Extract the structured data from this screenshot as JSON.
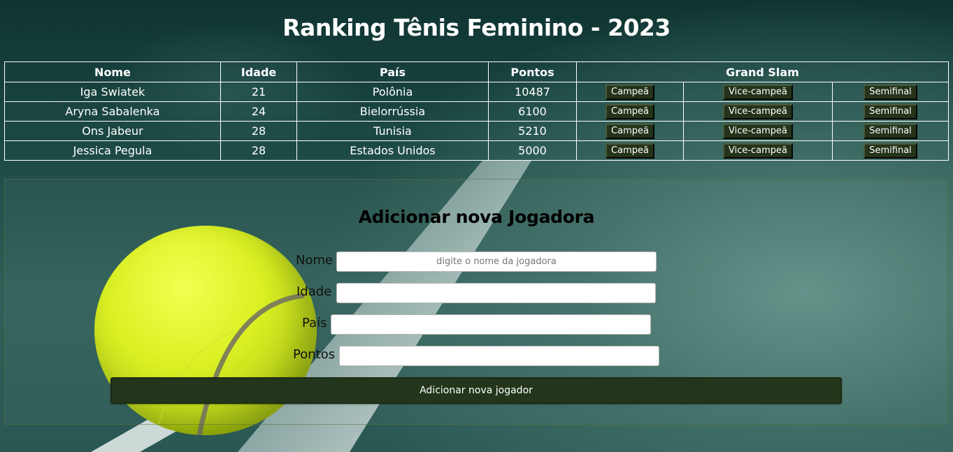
{
  "page": {
    "title": "Ranking Tênis Feminino - 2023"
  },
  "table": {
    "headers": {
      "name": "Nome",
      "age": "Idade",
      "country": "País",
      "points": "Pontos",
      "grand_slam": "Grand Slam"
    },
    "rows": [
      {
        "name": "Iga Swiatek",
        "age": "21",
        "country": "Polônia",
        "points": "10487"
      },
      {
        "name": "Aryna Sabalenka",
        "age": "24",
        "country": "Bielorrússia",
        "points": "6100"
      },
      {
        "name": "Ons Jabeur",
        "age": "28",
        "country": "Tunisia",
        "points": "5210"
      },
      {
        "name": "Jessica Pegula",
        "age": "28",
        "country": "Estados Unidos",
        "points": "5000"
      }
    ],
    "buttons": {
      "champion": "Campeã",
      "runner_up": "Vice-campeã",
      "semifinal": "Semifinal"
    }
  },
  "form": {
    "title": "Adicionar nova Jogadora",
    "name_label": "Nome",
    "name_placeholder": "digite o nome da jogadora",
    "name_value": "",
    "age_label": "Idade",
    "age_value": "",
    "country_label": "País",
    "country_value": "",
    "points_label": "Pontos",
    "points_value": "",
    "submit_label": "Adicionar nova jogador"
  },
  "colors": {
    "button_bg": "#24331a",
    "submit_bg": "#23361b",
    "ball": "#d9f01a"
  }
}
